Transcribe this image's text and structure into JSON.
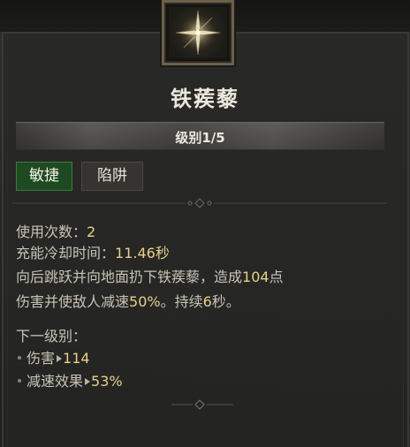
{
  "skill": {
    "icon": "caltrop-star-icon",
    "name": "铁蒺藜",
    "level_label": "级别1/5"
  },
  "tags": [
    "敏捷",
    "陷阱"
  ],
  "stats": {
    "charges_label": "使用次数：",
    "charges_value": "2",
    "cooldown_label": "充能冷却时间：",
    "cooldown_value": "11.46",
    "cooldown_unit": "秒"
  },
  "description": {
    "line1_a": "向后跳跃并向地面扔下铁蒺藜，造成",
    "line1_damage": "104",
    "line1_b": "点",
    "line2_a": "伤害并使敌人减速",
    "line2_slow": "50%",
    "line2_b": "。持续",
    "line2_duration": "6",
    "line2_c": "秒。"
  },
  "next_level": {
    "title": "下一级别：",
    "items": [
      {
        "label": "伤害",
        "value": "114"
      },
      {
        "label": "减速效果",
        "value": "53%"
      }
    ]
  },
  "colors": {
    "highlight": "#e8d08a",
    "tag_active_bg": "#1e4a22",
    "text": "#c8c3b6"
  }
}
